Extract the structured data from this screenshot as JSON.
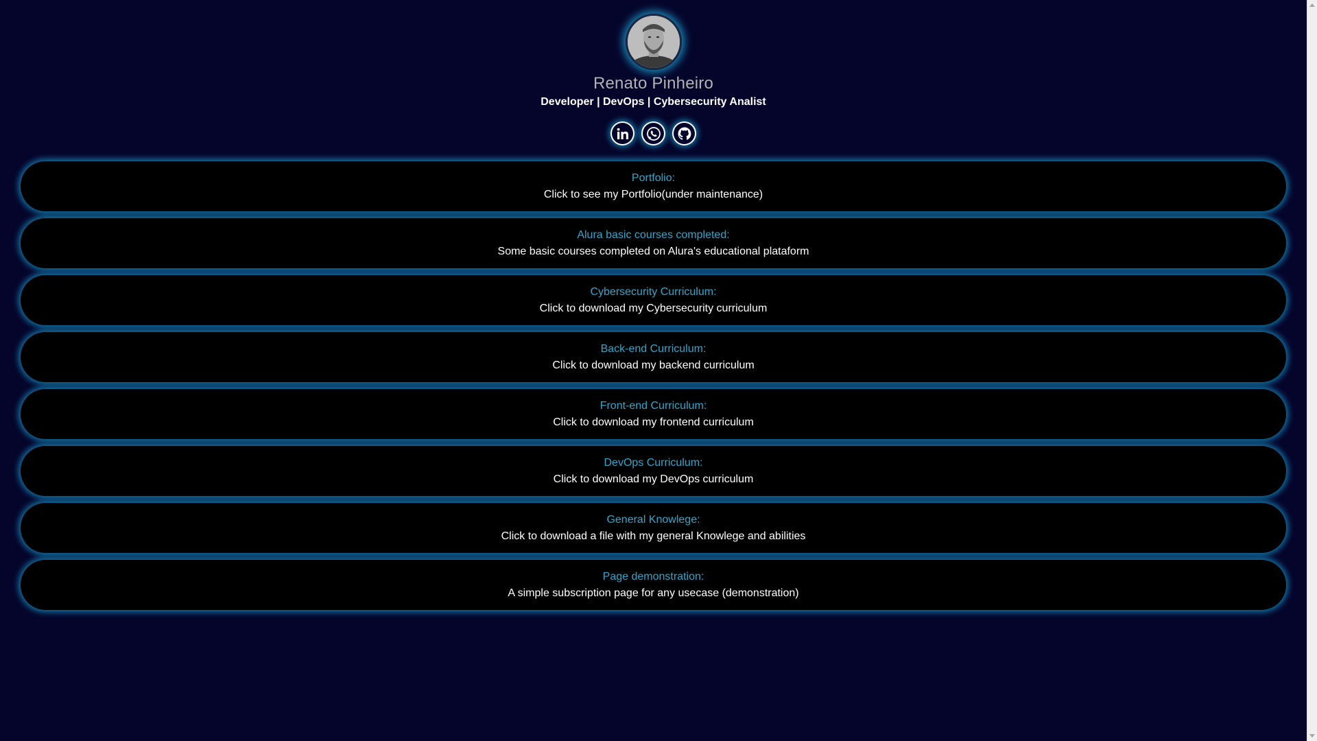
{
  "profile": {
    "name": "Renato Pinheiro",
    "headline": "Developer | DevOps | Cybersecurity Analist",
    "avatar_icon": "profile-photo"
  },
  "socials": [
    {
      "name": "linkedin",
      "icon": "linkedin-icon"
    },
    {
      "name": "whatsapp",
      "icon": "whatsapp-icon"
    },
    {
      "name": "github",
      "icon": "github-icon"
    }
  ],
  "links": [
    {
      "title": "Portfolio:",
      "desc": "Click to see my Portfolio(under maintenance)"
    },
    {
      "title": "Alura basic courses completed:",
      "desc": "Some basic courses completed on Alura's educational plataform"
    },
    {
      "title": "Cybersecurity Curriculum:",
      "desc": "Click to download my Cybersecurity curriculum"
    },
    {
      "title": "Back-end Curriculum:",
      "desc": "Click to download my backend curriculum"
    },
    {
      "title": "Front-end Curriculum:",
      "desc": "Click to download my frontend curriculum"
    },
    {
      "title": "DevOps Curriculum:",
      "desc": "Click to download my DevOps curriculum"
    },
    {
      "title": "General Knowlege:",
      "desc": "Click to download a file with my general Knowlege and abilities"
    },
    {
      "title": "Page demonstration:",
      "desc": "A simple subscription page for any usecase (demonstration)"
    }
  ],
  "colors": {
    "background": "#05052b",
    "card_background": "#000000",
    "accent": "#2fa7cc",
    "glow": "#1e96c8"
  }
}
